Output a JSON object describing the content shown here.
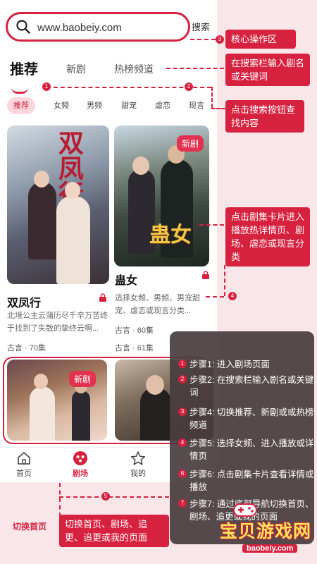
{
  "search": {
    "url_value": "www.baobeiy.com",
    "button_label": "搜索"
  },
  "tabs": [
    {
      "label": "推荐",
      "active": true
    },
    {
      "label": "新剧",
      "active": false
    },
    {
      "label": "热榜频道",
      "active": false
    }
  ],
  "chips": [
    {
      "label": "推荐",
      "active": true
    },
    {
      "label": "女频"
    },
    {
      "label": "男频"
    },
    {
      "label": "甜宠"
    },
    {
      "label": "虐恋"
    },
    {
      "label": "现言"
    }
  ],
  "cards": [
    {
      "poster_text": "双凤行",
      "title": "双凤行",
      "desc": "北境公主云蒲历尽千辛万苦终于找到了失散的挚终云啊...",
      "meta": "古言 · 70集"
    },
    {
      "poster_text": "蛊女",
      "badge": "新剧",
      "title": "蛊女",
      "desc": "选择女频、男频、男宠甜宠、虐恋或现言分类...",
      "meta": "古言 · 60集"
    },
    {
      "badge": "新剧",
      "meta": "古言 · 61集"
    }
  ],
  "bottom_nav": [
    {
      "label": "首页",
      "icon": "home-icon"
    },
    {
      "label": "剧场",
      "icon": "theater-icon",
      "active": true
    },
    {
      "label": "我的",
      "icon": "star-icon"
    }
  ],
  "callouts": {
    "core_area": "核心操作区",
    "search_input": "在搜索栏输入剧名或关键词",
    "click_search": "点击搜索按钮查找内容",
    "click_card": "点击剧集卡片进入播放热详情页、剧场、虐恋或现言分类",
    "bottom_nav": "切换首页、剧场、追更、追更或我的页面",
    "home_label": "切换首页"
  },
  "steps": [
    {
      "n": "1",
      "text": "步骤1: 进入剧场页面"
    },
    {
      "n": "2",
      "text": "步骤2: 在搜索栏输入剧名或关键词"
    },
    {
      "n": "3",
      "text": "步骤4: 切换推荐、新剧或或热榜频道"
    },
    {
      "n": "4",
      "text": "步骤5: 选择女频、进入播放或详情页"
    },
    {
      "n": "6",
      "text": "步骤6: 点击剧集卡片查看详情或播放"
    },
    {
      "n": "7",
      "text": "步骤7: 通过底部导航切换首页、剧场、追更或我的页面"
    }
  ],
  "markers": [
    "1",
    "2",
    "3",
    "4",
    "5"
  ],
  "watermark": {
    "title": "宝贝游戏网",
    "url": "baobeiy.com"
  },
  "colors": {
    "accent": "#d6213f",
    "background": "#f9e6e9",
    "step_panel": "#483c3e"
  }
}
